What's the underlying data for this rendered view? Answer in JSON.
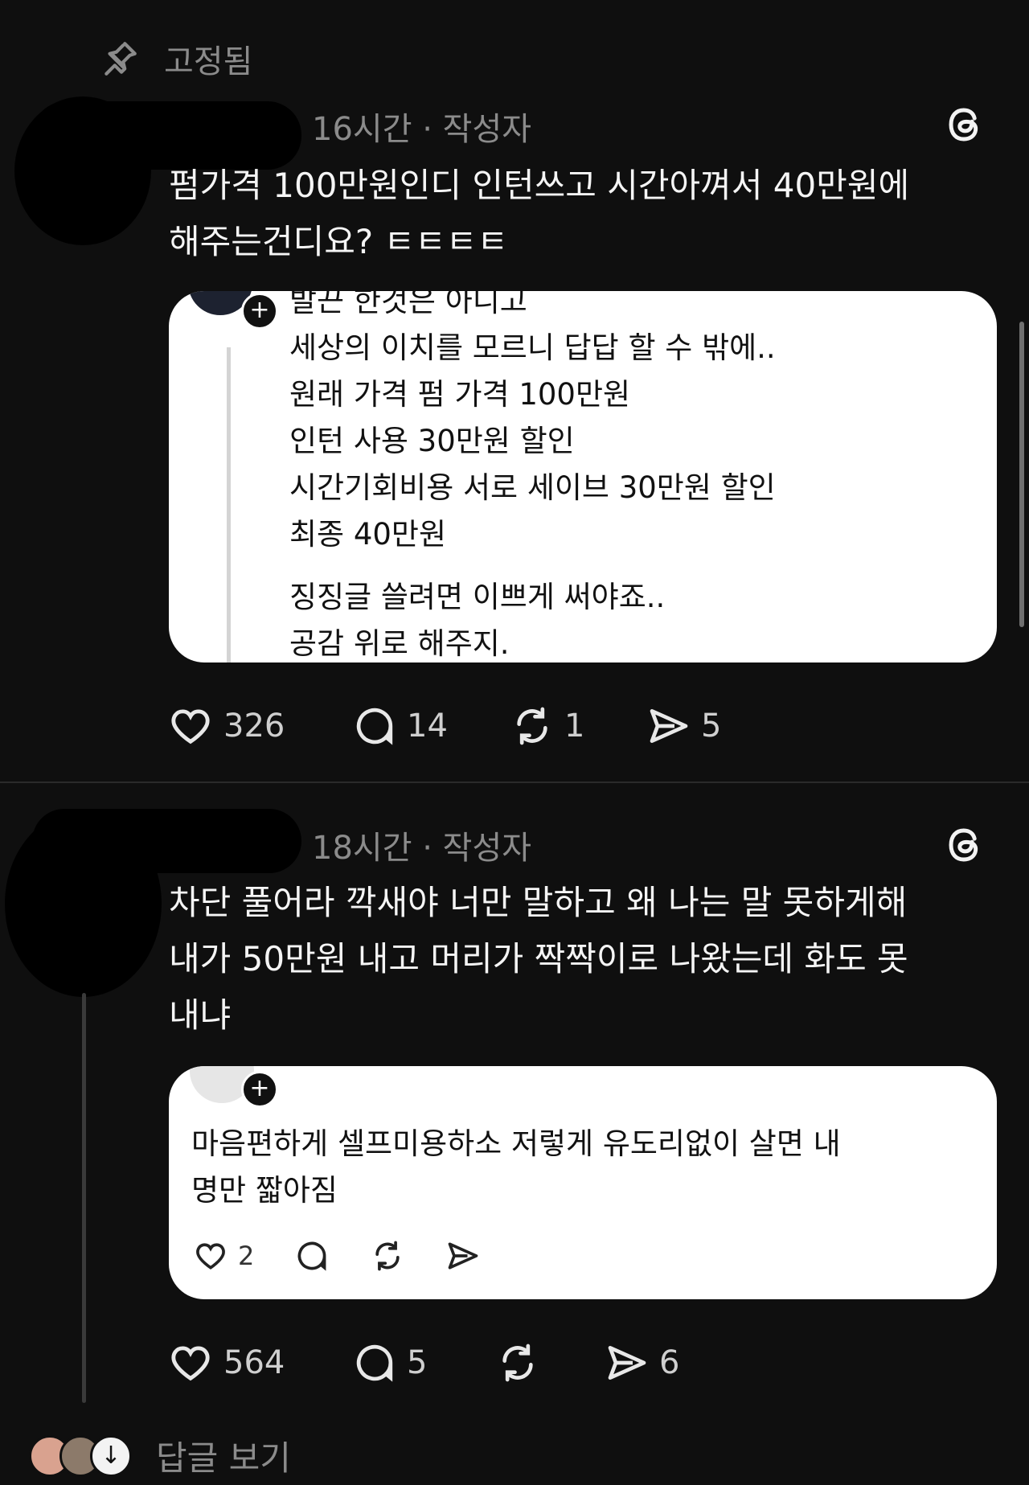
{
  "pinned": {
    "label": "고정됨"
  },
  "post1": {
    "meta": "16시간 · 작성자",
    "text_lines": [
      "펌가격 100만원인디 인턴쓰고 시간아껴서 40만원에",
      "해주는건디요? ㅌㅌㅌㅌ"
    ],
    "quote": {
      "partial_top": "발끈 한것은 아니고",
      "lines": [
        "세상의 이치를 모르니 답답 할 수 밖에..",
        "원래 가격 펌 가격 100만원",
        "인턴 사용 30만원 할인",
        "시간기회비용 서로 세이브 30만원 할인",
        "최종 40만원"
      ],
      "lines2": [
        "징징글 쓸려면 이쁘게 써야죠..",
        "공감 위로 해주지."
      ]
    },
    "actions": {
      "likes": "326",
      "replies": "14",
      "reposts": "1",
      "shares": "5"
    }
  },
  "post2": {
    "meta": "18시간 · 작성자",
    "text_lines": [
      "차단 풀어라 깍새야 너만 말하고 왜 나는 말 못하게해",
      "내가 50만원 내고 머리가 짝짝이로 나왔는데 화도 못",
      "내냐"
    ],
    "quote": {
      "lines": [
        "마음편하게 셀프미용하소 저렇게 유도리없이 살면 내",
        "명만 짧아짐"
      ],
      "actions": {
        "likes": "2"
      }
    },
    "actions": {
      "likes": "564",
      "replies": "5",
      "shares": "6"
    }
  },
  "footer": {
    "view_replies": "답글 보기"
  },
  "icons": [
    "pin-icon",
    "threads-icon",
    "heart-icon",
    "comment-icon",
    "repost-icon",
    "share-icon",
    "plus-icon",
    "arrow-down-icon"
  ]
}
